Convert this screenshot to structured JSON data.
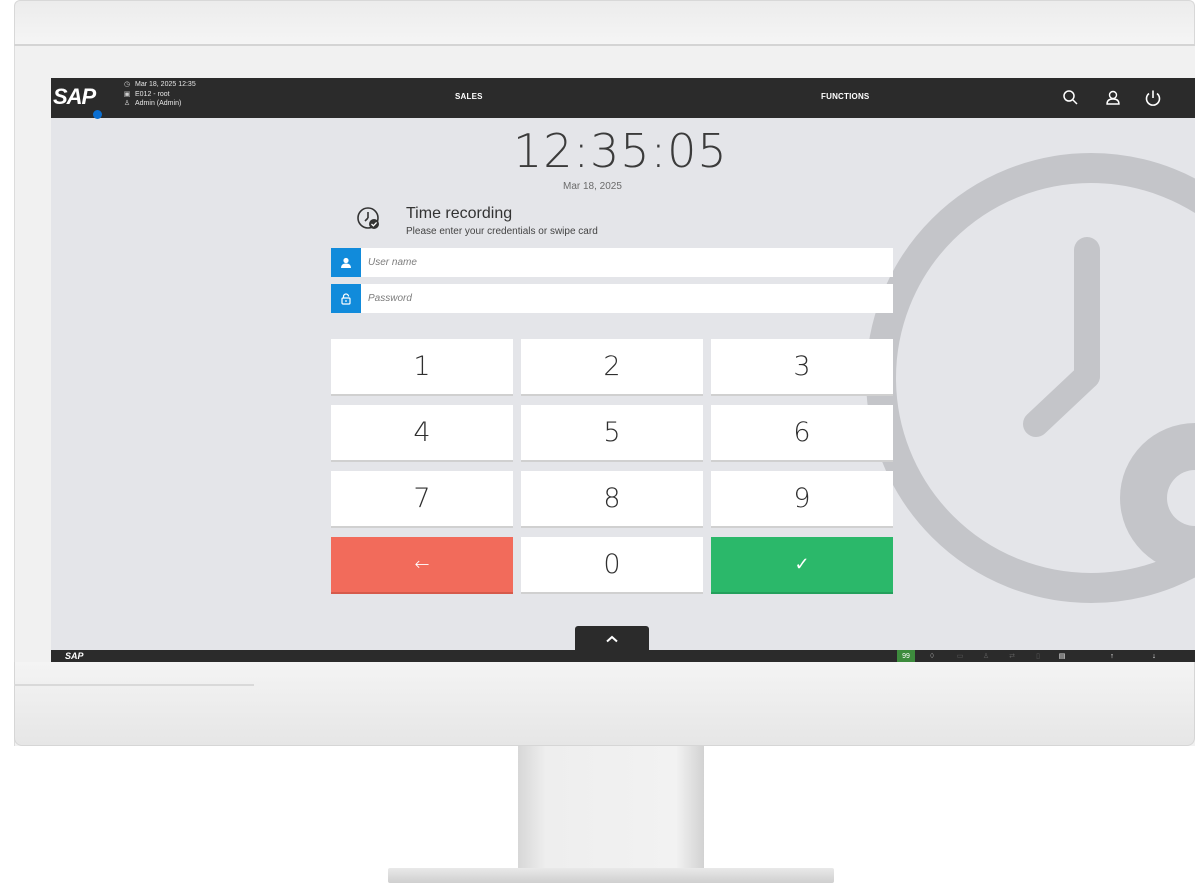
{
  "header": {
    "datetime": "Mar 18, 2025 12:35",
    "store": "E012 - root",
    "user": "Admin (Admin)",
    "nav_sales": "SALES",
    "nav_functions": "FUNCTIONS"
  },
  "clock": {
    "time": "12:35:05",
    "date": "Mar 18, 2025"
  },
  "time_recording": {
    "title": "Time recording",
    "subtitle": "Please enter your credentials or swipe card"
  },
  "fields": {
    "username_placeholder": "User name",
    "password_placeholder": "Password"
  },
  "keypad": {
    "keys": [
      "1",
      "2",
      "3",
      "4",
      "5",
      "6",
      "7",
      "8",
      "9",
      "0"
    ],
    "back_symbol": "←",
    "ok_symbol": "✓"
  },
  "footer": {
    "badge_count": "99"
  },
  "colors": {
    "accent_blue": "#118bdb",
    "back_red": "#f26b5b",
    "confirm_green": "#2bb86a",
    "bar_dark": "#2b2b2b"
  }
}
